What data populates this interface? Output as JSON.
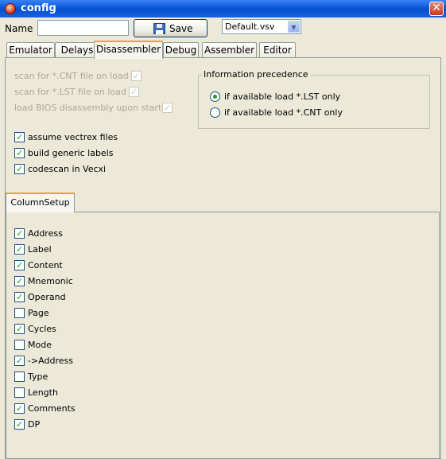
{
  "window": {
    "title": "config",
    "close": "✕"
  },
  "toolbar": {
    "name_label": "Name",
    "name_value": "",
    "save_label": "Save",
    "file_select": "Default.vsv",
    "dropdown_arrow": "▼"
  },
  "tabs": [
    {
      "label": "Emulator",
      "active": false
    },
    {
      "label": "Delays",
      "active": false
    },
    {
      "label": "Disassembler",
      "active": true
    },
    {
      "label": "Debug",
      "active": false
    },
    {
      "label": "Assembler",
      "active": false
    },
    {
      "label": "Editor",
      "active": false
    }
  ],
  "disassembler": {
    "disabled_options": [
      {
        "label": "scan for *.CNT file on load",
        "checked": true
      },
      {
        "label": "scan for *.LST file on load",
        "checked": true
      },
      {
        "label": "load BIOS disassembly upon start",
        "checked": true
      }
    ],
    "options": [
      {
        "label": "assume vectrex files",
        "checked": true
      },
      {
        "label": "build generic labels",
        "checked": true
      },
      {
        "label": "codescan in Vecxi",
        "checked": true
      }
    ],
    "info_group": {
      "title": "Information precedence",
      "radios": [
        {
          "label": "if available load *.LST only",
          "selected": true
        },
        {
          "label": "if available load *.CNT only",
          "selected": false
        }
      ]
    },
    "column_tab": "ColumnSetup",
    "columns": [
      {
        "label": "Address",
        "checked": true
      },
      {
        "label": "Label",
        "checked": true
      },
      {
        "label": "Content",
        "checked": true
      },
      {
        "label": "Mnemonic",
        "checked": true
      },
      {
        "label": "Operand",
        "checked": true
      },
      {
        "label": "Page",
        "checked": false
      },
      {
        "label": "Cycles",
        "checked": true
      },
      {
        "label": "Mode",
        "checked": false
      },
      {
        "label": "->Address",
        "checked": true
      },
      {
        "label": "Type",
        "checked": false
      },
      {
        "label": "Length",
        "checked": false
      },
      {
        "label": "Comments",
        "checked": true
      },
      {
        "label": "DP",
        "checked": true
      }
    ]
  },
  "colors": {
    "title_bar": "#0a57d8",
    "check": "#21a121",
    "active_tab_accent": "#e8a531"
  }
}
